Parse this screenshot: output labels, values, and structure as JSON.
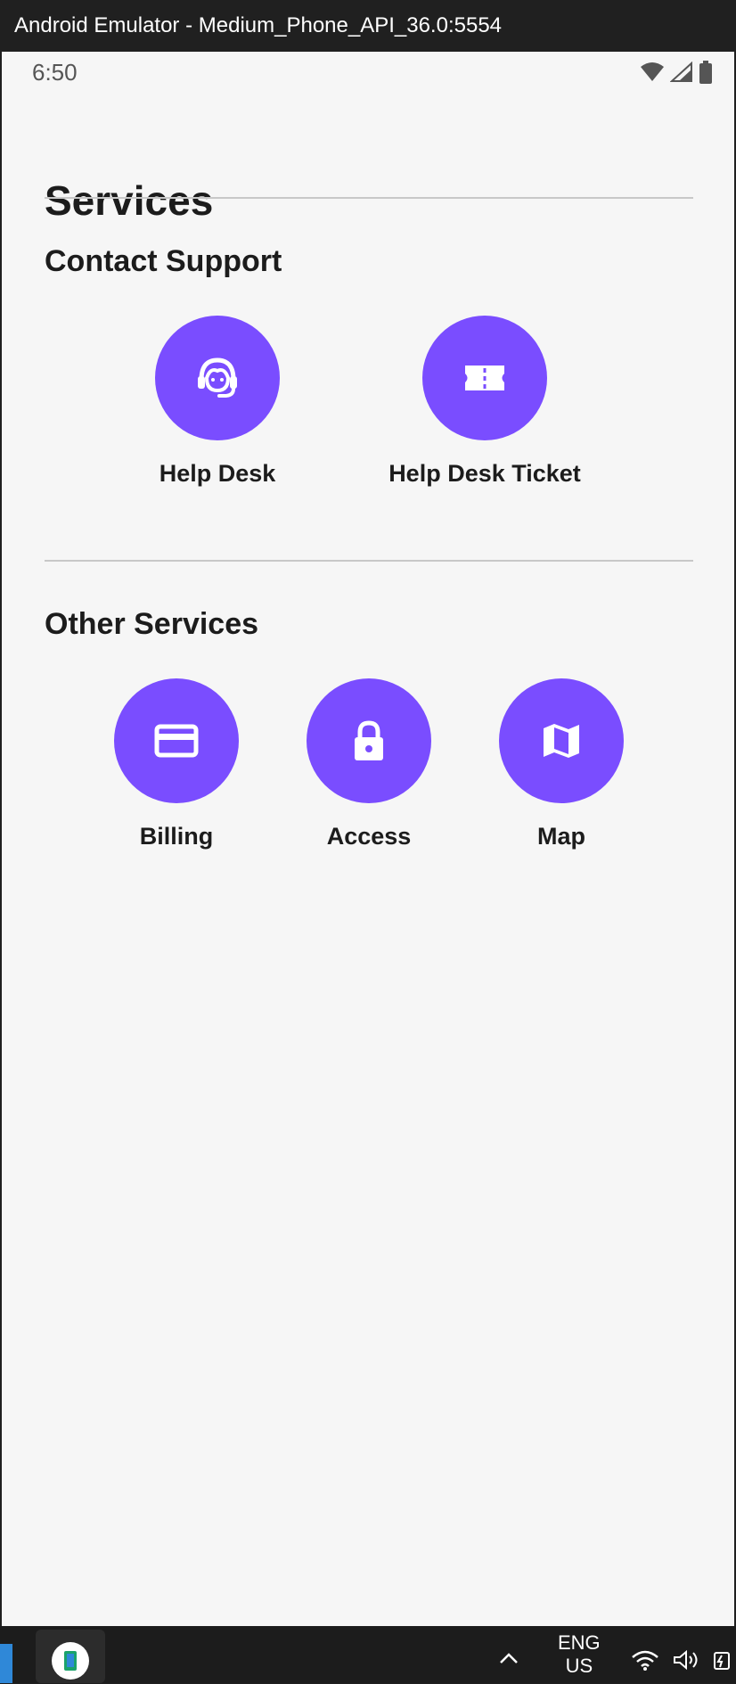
{
  "window": {
    "title": "Android Emulator - Medium_Phone_API_36.0:5554"
  },
  "status_bar": {
    "time": "6:50",
    "icons": [
      "wifi-icon",
      "signal-icon",
      "battery-icon"
    ]
  },
  "page": {
    "title": "Services"
  },
  "sections": [
    {
      "title": "Contact Support",
      "items": [
        {
          "label": "Help Desk",
          "icon": "headset-agent-icon"
        },
        {
          "label": "Help Desk Ticket",
          "icon": "ticket-icon"
        }
      ]
    },
    {
      "title": "Other Services",
      "items": [
        {
          "label": "Billing",
          "icon": "credit-card-icon"
        },
        {
          "label": "Access",
          "icon": "lock-icon"
        },
        {
          "label": "Map",
          "icon": "map-icon"
        }
      ]
    }
  ],
  "colors": {
    "accent": "#7a4dff",
    "background": "#f6f6f6",
    "text": "#1c1c1c"
  },
  "taskbar": {
    "language_line1": "ENG",
    "language_line2": "US",
    "icons": [
      "emulator-app-icon",
      "chevron-up-icon",
      "wifi-icon",
      "speaker-icon",
      "battery-icon"
    ]
  }
}
